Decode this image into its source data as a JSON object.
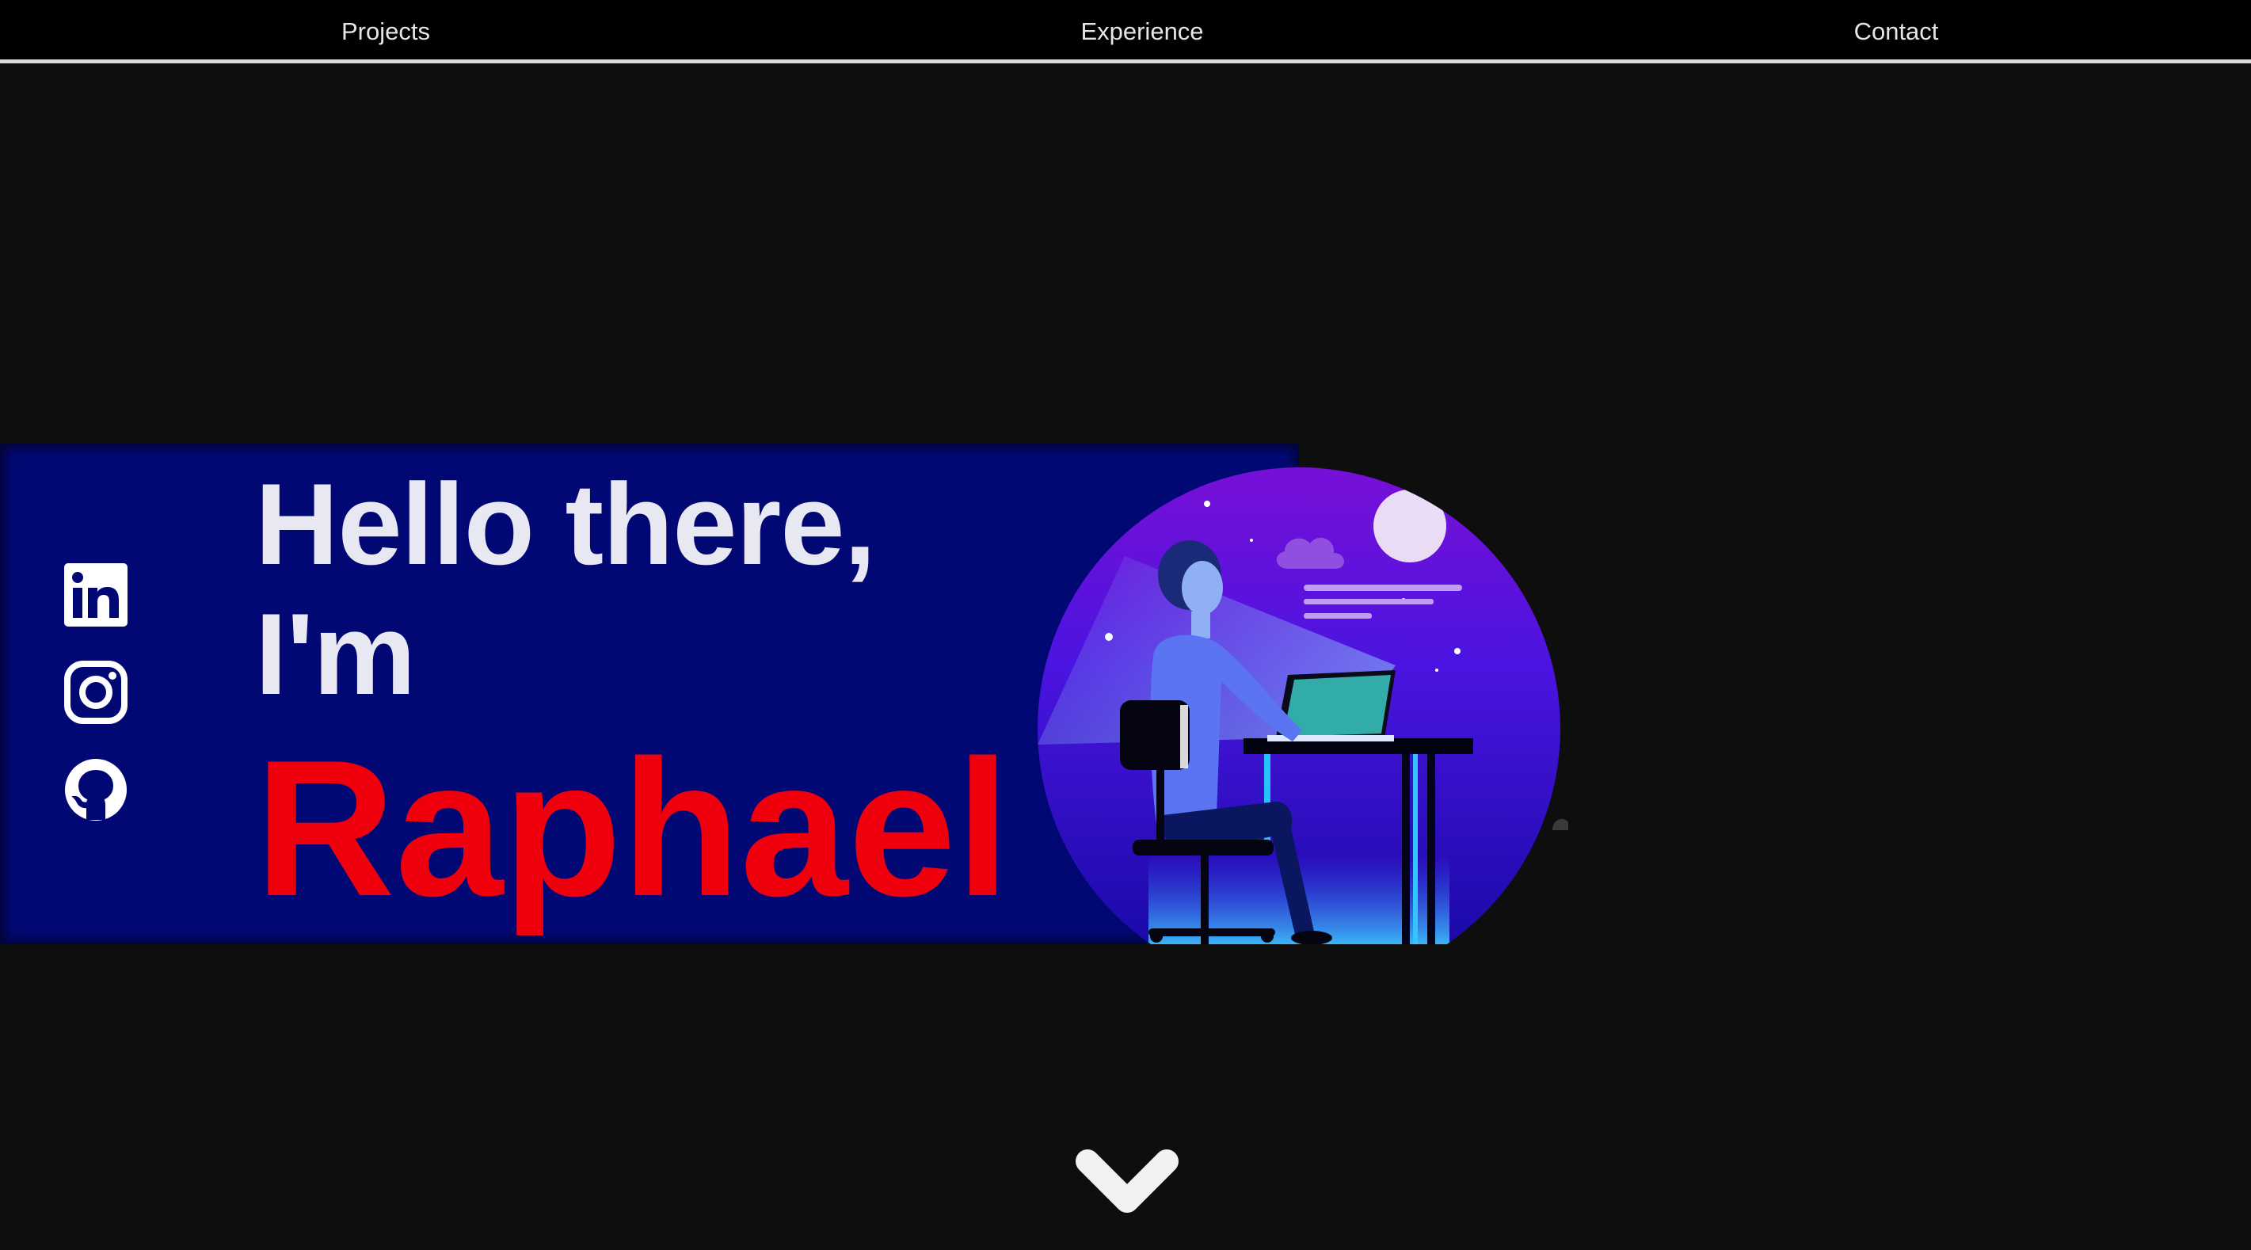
{
  "nav": {
    "items": [
      {
        "label": "Projects"
      },
      {
        "label": "Experience"
      },
      {
        "label": "Contact"
      }
    ]
  },
  "hero": {
    "greeting_line1": "Hello there,",
    "greeting_line2": "I'm",
    "name": "Raphael",
    "socials": [
      {
        "icon": "linkedin-icon"
      },
      {
        "icon": "instagram-icon"
      },
      {
        "icon": "github-icon"
      }
    ],
    "illustration": "developer-at-desk-night-illustration"
  },
  "scroll": {
    "icon": "chevron-down-icon"
  },
  "colors": {
    "page_background": "#0e0e0e",
    "nav_background": "#000000",
    "band_background": "#020873",
    "name_red": "#f0000c",
    "greeting_text": "#e8e8f2"
  }
}
